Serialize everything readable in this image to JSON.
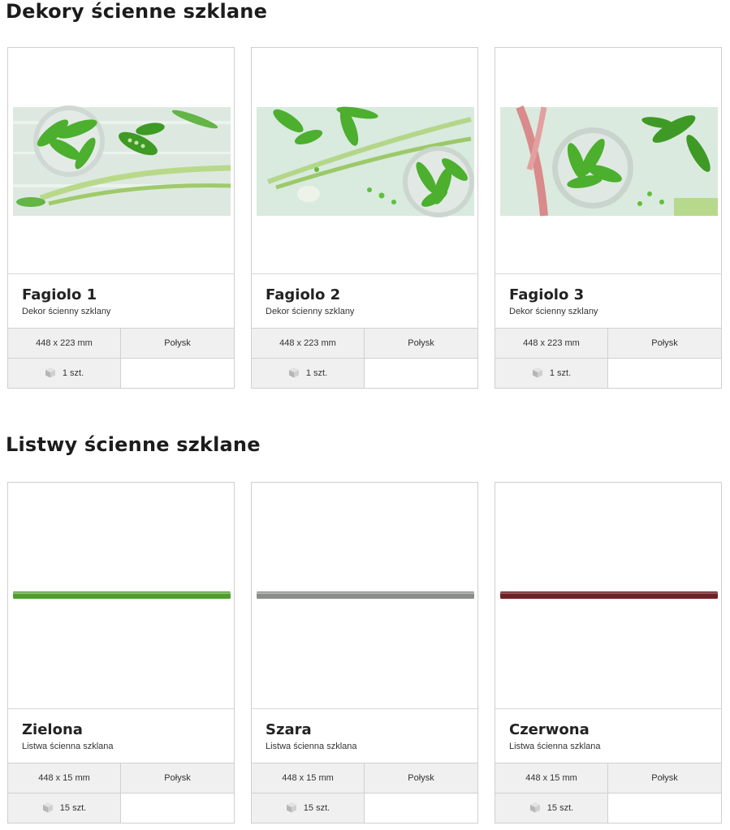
{
  "sections": [
    {
      "title": "Dekory ścienne szklane",
      "products": [
        {
          "name": "Fagiolo 1",
          "description": "Dekor ścienny szklany",
          "size": "448 x 223 mm",
          "finish": "Połysk",
          "quantity": "1 szt."
        },
        {
          "name": "Fagiolo 2",
          "description": "Dekor ścienny szklany",
          "size": "448 x 223 mm",
          "finish": "Połysk",
          "quantity": "1 szt."
        },
        {
          "name": "Fagiolo 3",
          "description": "Dekor ścienny szklany",
          "size": "448 x 223 mm",
          "finish": "Połysk",
          "quantity": "1 szt."
        }
      ]
    },
    {
      "title": "Listwy ścienne szklane",
      "products": [
        {
          "name": "Zielona",
          "description": "Listwa ścienna szklana",
          "size": "448 x 15 mm",
          "finish": "Połysk",
          "quantity": "15 szt.",
          "strip_color": "#4f9e2c"
        },
        {
          "name": "Szara",
          "description": "Listwa ścienna szklana",
          "size": "448 x 15 mm",
          "finish": "Połysk",
          "quantity": "15 szt.",
          "strip_color": "#8a8d8a"
        },
        {
          "name": "Czerwona",
          "description": "Listwa ścienna szklana",
          "size": "448 x 15 mm",
          "finish": "Połysk",
          "quantity": "15 szt.",
          "strip_color": "#6e2226"
        }
      ]
    }
  ],
  "colors": {
    "text": "#222222",
    "spec_background": "#f0f0f0",
    "card_border": "#cfcfcf",
    "pea_green": "#4caf2e",
    "background_mint": "#dfeee3"
  },
  "icons": {
    "quantity": "package-box-icon"
  }
}
